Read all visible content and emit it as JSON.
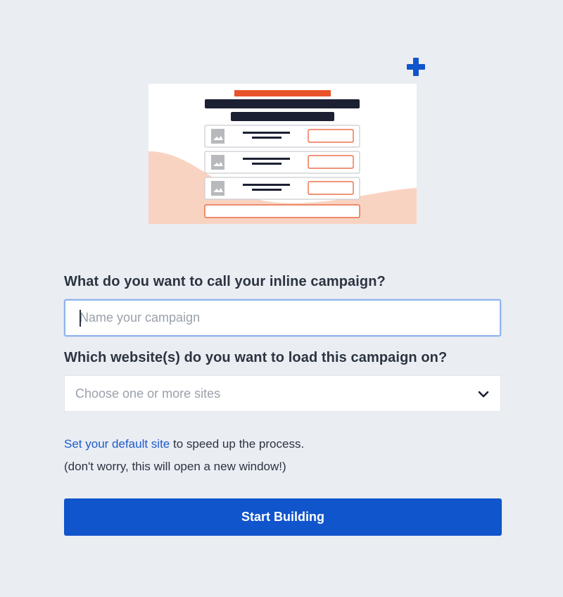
{
  "colors": {
    "background": "#eaedf2",
    "accent_blue": "#1155cc",
    "link_blue": "#1d5ccc",
    "illustration_orange": "#e8532b",
    "illustration_peach": "#f9d3c2",
    "illustration_dark": "#1b2033"
  },
  "icons": {
    "add": "plus-icon",
    "dropdown": "chevron-down-icon",
    "illustration": "inline-campaign-illustration"
  },
  "form": {
    "name_label": "What do you want to call your inline campaign?",
    "name_placeholder": "Name your campaign",
    "name_value": "",
    "sites_label": "Which website(s) do you want to load this campaign on?",
    "sites_placeholder": "Choose one or more sites"
  },
  "helper": {
    "link_text": "Set your default site",
    "rest_text": " to speed up the process.",
    "note": "(don't worry, this will open a new window!)"
  },
  "actions": {
    "start_label": "Start Building"
  }
}
